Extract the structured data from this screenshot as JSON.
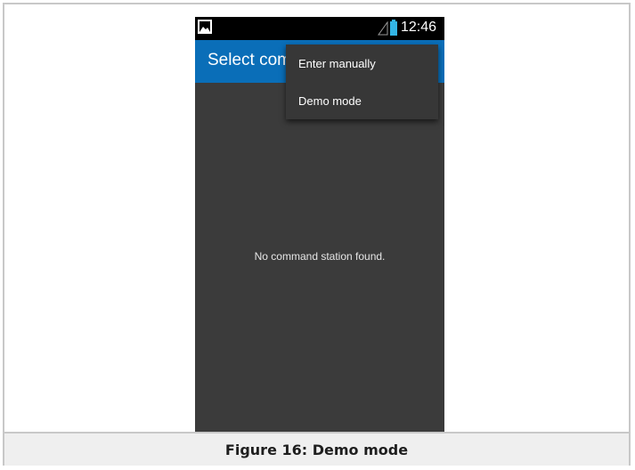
{
  "status_bar": {
    "time": "12:46",
    "notification_icon": "image-icon",
    "signal_icon": "signal-icon",
    "battery_icon": "battery-icon",
    "battery_color": "#33b5e5"
  },
  "action_bar": {
    "title": "Select com",
    "color": "#0a6eb8"
  },
  "main": {
    "empty_message": "No command station found.",
    "background": "#3b3b3b"
  },
  "overflow_menu": {
    "items": [
      {
        "label": "Enter manually"
      },
      {
        "label": "Demo mode"
      }
    ]
  },
  "caption": {
    "text": "Figure 16: Demo mode"
  }
}
